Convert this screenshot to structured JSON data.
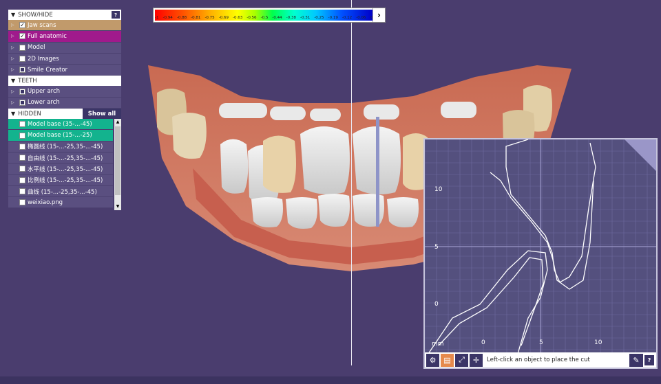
{
  "color_scale": {
    "ticks": [
      "-1",
      "-0.94",
      "-0.88",
      "-0.81",
      "-0.75",
      "-0.69",
      "-0.63",
      "-0.56",
      "-0.5",
      "-0.44",
      "-0.38",
      "-0.31",
      "-0.25",
      "-0.19",
      "-0.12",
      "-0.06",
      "0"
    ],
    "arrow": "›"
  },
  "panel": {
    "showhide": {
      "title": "SHOW/HIDE",
      "help": "?",
      "items": [
        {
          "label": "Jaw scans"
        },
        {
          "label": "Full anatomic"
        },
        {
          "label": "Model"
        },
        {
          "label": "2D Images"
        },
        {
          "label": "Smile Creator"
        }
      ]
    },
    "teeth": {
      "title": "TEETH",
      "items": [
        {
          "label": "Upper arch"
        },
        {
          "label": "Lower arch"
        }
      ]
    },
    "hidden": {
      "title": "HIDDEN",
      "show_all": "Show all",
      "items": [
        {
          "label": "Model base (35-...-45)"
        },
        {
          "label": "Model base (15-...-25)"
        },
        {
          "label": "椭圆线 (15-...-25,35-...-45)"
        },
        {
          "label": "自由线 (15-...-25,35-...-45)"
        },
        {
          "label": "水平线 (15-...-25,35-...-45)"
        },
        {
          "label": "比例线 (15-...-25,35-...-45)"
        },
        {
          "label": "曲线 (15-...-25,35-...-45)"
        },
        {
          "label": "weixiao.png"
        }
      ]
    }
  },
  "cross_section": {
    "axis_unit": "mm",
    "x_ticks": [
      "0",
      "5",
      "10"
    ],
    "y_ticks": [
      "10",
      "5",
      "0"
    ],
    "instruction": "Left-click an object to place the cut",
    "help": "?"
  },
  "colors": {
    "background": "#4a3d6e",
    "panel_row": "#5a4f80",
    "jaw_scans_row": "#c19a6b",
    "full_anatomic_row": "#a01a8c",
    "selected_hidden_row": "#13b38e",
    "active_tool": "#e68a4c"
  }
}
